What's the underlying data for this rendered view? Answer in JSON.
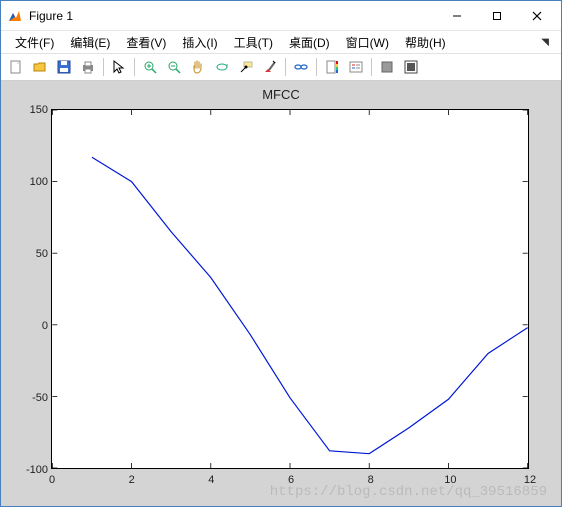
{
  "window": {
    "title": "Figure 1"
  },
  "menu": {
    "file": "文件(F)",
    "edit": "编辑(E)",
    "view": "查看(V)",
    "insert": "插入(I)",
    "tools": "工具(T)",
    "desktop": "桌面(D)",
    "window": "窗口(W)",
    "help": "帮助(H)"
  },
  "toolbar": {
    "new": "new-figure",
    "open": "open",
    "save": "save",
    "print": "print",
    "pointer": "edit-plot",
    "zoom_in": "zoom-in",
    "zoom_out": "zoom-out",
    "pan": "pan",
    "rotate": "rotate-3d",
    "data_cursor": "data-cursor",
    "brush": "brush",
    "link": "link-plot",
    "colorbar": "insert-colorbar",
    "legend": "insert-legend",
    "hide_tools": "hide-plot-tools",
    "dock": "dock-figure"
  },
  "chart_data": {
    "type": "line",
    "title": "MFCC",
    "xlabel": "",
    "ylabel": "",
    "xlim": [
      0,
      12
    ],
    "ylim": [
      -100,
      150
    ],
    "xticks": [
      0,
      2,
      4,
      6,
      8,
      10,
      12
    ],
    "yticks": [
      -100,
      -50,
      0,
      50,
      100,
      150
    ],
    "series": [
      {
        "name": "MFCC",
        "color": "#0017d6",
        "x": [
          1,
          2,
          3,
          4,
          5,
          6,
          7,
          8,
          9,
          10,
          11,
          12
        ],
        "values": [
          117,
          100,
          65,
          33,
          -7,
          -51,
          -88,
          -90,
          -72,
          -52,
          -20,
          -2
        ]
      }
    ]
  },
  "watermark": "https://blog.csdn.net/qq_39516859"
}
